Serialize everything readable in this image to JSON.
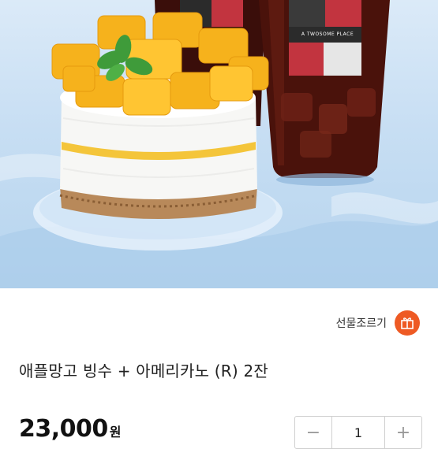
{
  "hero": {
    "brand_text": "A TWOSOME PLACE"
  },
  "gift": {
    "label": "선물조르기",
    "icon": "gift-box-icon",
    "accent_color": "#ee5a24"
  },
  "product": {
    "title": "애플망고 빙수 + 아메리카노 (R) 2잔",
    "price": "23,000",
    "price_unit": "원"
  },
  "quantity": {
    "minus_label": "−",
    "value": "1",
    "plus_label": "+"
  }
}
